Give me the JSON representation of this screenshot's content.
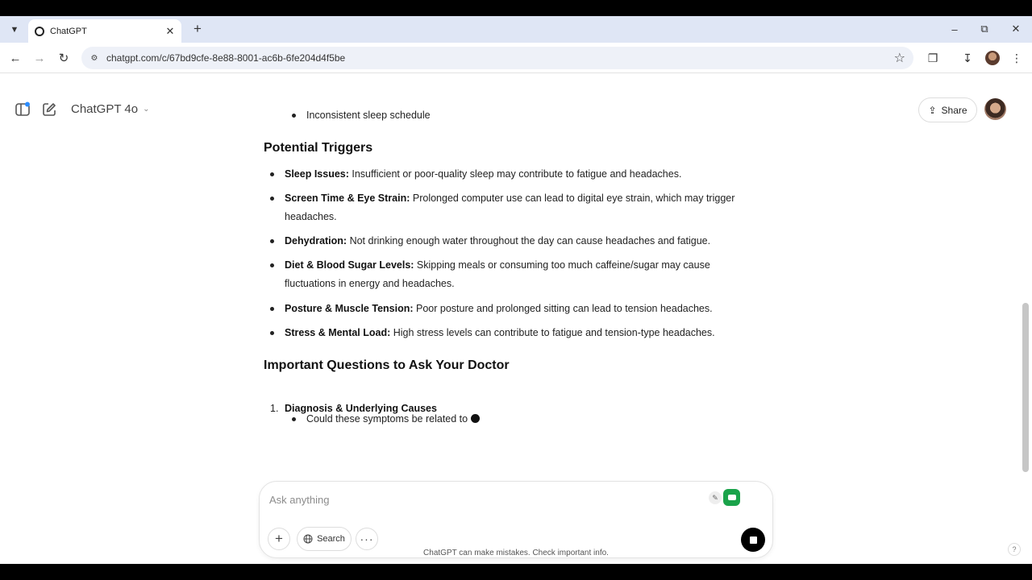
{
  "browser": {
    "tab_title": "ChatGPT",
    "url": "chatgpt.com/c/67bd9cfe-8e88-8001-ac6b-6fe204d4f5be"
  },
  "header": {
    "model_label": "ChatGPT 4o",
    "share_label": "Share"
  },
  "content": {
    "prev_bullet": "Inconsistent sleep schedule",
    "triggers_heading": "Potential Triggers",
    "triggers": [
      {
        "title": "Sleep Issues:",
        "text": " Insufficient or poor-quality sleep may contribute to fatigue and headaches."
      },
      {
        "title": "Screen Time & Eye Strain:",
        "text": " Prolonged computer use can lead to digital eye strain, which may trigger headaches."
      },
      {
        "title": "Dehydration:",
        "text": " Not drinking enough water throughout the day can cause headaches and fatigue."
      },
      {
        "title": "Diet & Blood Sugar Levels:",
        "text": " Skipping meals or consuming too much caffeine/sugar may cause fluctuations in energy and headaches."
      },
      {
        "title": "Posture & Muscle Tension:",
        "text": " Poor posture and prolonged sitting can lead to tension headaches."
      },
      {
        "title": "Stress & Mental Load:",
        "text": " High stress levels can contribute to fatigue and tension-type headaches."
      }
    ],
    "questions_heading": "Important Questions to Ask Your Doctor",
    "q1_number": "1.",
    "q1_title": "Diagnosis & Underlying Causes",
    "q1_sub": "Could these symptoms be related to"
  },
  "composer": {
    "placeholder": "Ask anything",
    "search_label": "Search"
  },
  "footer": {
    "disclaimer": "ChatGPT can make mistakes. Check important info.",
    "help": "?"
  }
}
